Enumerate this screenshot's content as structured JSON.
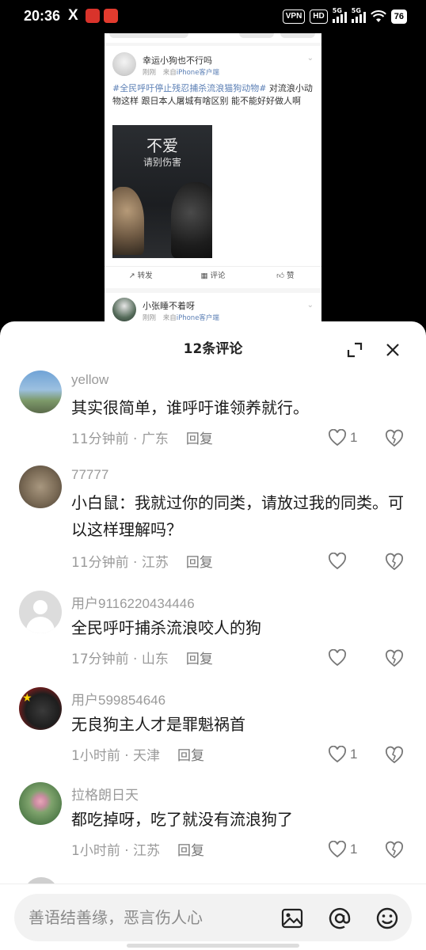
{
  "status_bar": {
    "time": "20:36",
    "x_icon": "X",
    "vpn": "VPN",
    "hd": "HD",
    "signal1": "5G",
    "signal2": "5G",
    "battery": "76"
  },
  "post": {
    "author": "幸运小狗也不行吗",
    "time": "刚刚",
    "source_prefix": "来自",
    "source": "iPhone客户端",
    "hashtag": "#全民呼吁停止残忍捕杀流浪猫狗动物#",
    "text": " 对流浪小动物这样 跟日本人屠城有啥区别 能不能好好做人啊",
    "image_title": "不爱",
    "image_subtitle": "请别伤害",
    "actions": {
      "repost": "转发",
      "comment": "评论",
      "like": "赞"
    },
    "second_author": "小张睡不着呀",
    "second_time": "刚刚",
    "second_source": "iPhone客户端"
  },
  "sheet": {
    "title": "12条评论"
  },
  "comments": [
    {
      "name": "yellow",
      "text": "其实很简单，谁呼吁谁领养就行。",
      "time_loc": "11分钟前 · 广东",
      "reply": "回复",
      "likes": "1",
      "avatar_color": "#6b9ac4"
    },
    {
      "name": "77777",
      "text": "小白鼠：我就过你的同类，请放过我的同类。可以这样理解吗？",
      "time_loc": "11分钟前 · 江苏",
      "reply": "回复",
      "likes": "",
      "avatar_color": "#8a7a66"
    },
    {
      "name": "用户9116220434446",
      "text": "全民呼吁捕杀流浪咬人的狗",
      "time_loc": "17分钟前 · 山东",
      "reply": "回复",
      "likes": "",
      "avatar_color": "#d9d9d9"
    },
    {
      "name": "用户599854646",
      "text": "无良狗主人才是罪魁祸首",
      "time_loc": "1小时前 · 天津",
      "reply": "回复",
      "likes": "1",
      "avatar_color": "#7a1f1f"
    },
    {
      "name": "拉格朗日天",
      "text": "都吃掉呀，吃了就没有流浪狗了",
      "time_loc": "1小时前 · 江苏",
      "reply": "回复",
      "likes": "1",
      "avatar_color": "#7fa36d"
    }
  ],
  "input": {
    "placeholder": "善语结善缘，恶言伤人心"
  }
}
